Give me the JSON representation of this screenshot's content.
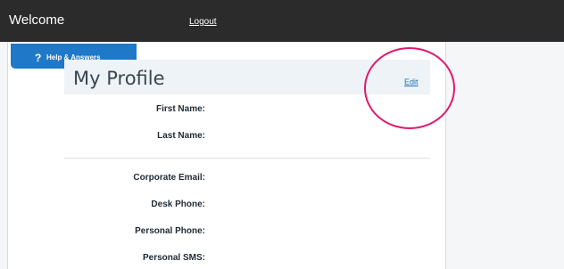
{
  "topbar": {
    "title": "Welcome",
    "logout_label": "Logout"
  },
  "help": {
    "icon": "?",
    "label": "Help & Answers"
  },
  "profile": {
    "title": "My Profile",
    "edit_label": "Edit",
    "name_fields": [
      "First Name:",
      "Last Name:"
    ],
    "contact_fields": [
      "Corporate Email:",
      "Desk Phone:",
      "Personal Phone:",
      "Personal SMS:"
    ]
  },
  "colors": {
    "topbar": "#2b2b2b",
    "help_button": "#1f78c8",
    "highlight_circle": "#e0186f",
    "link": "#1b6fb8"
  }
}
